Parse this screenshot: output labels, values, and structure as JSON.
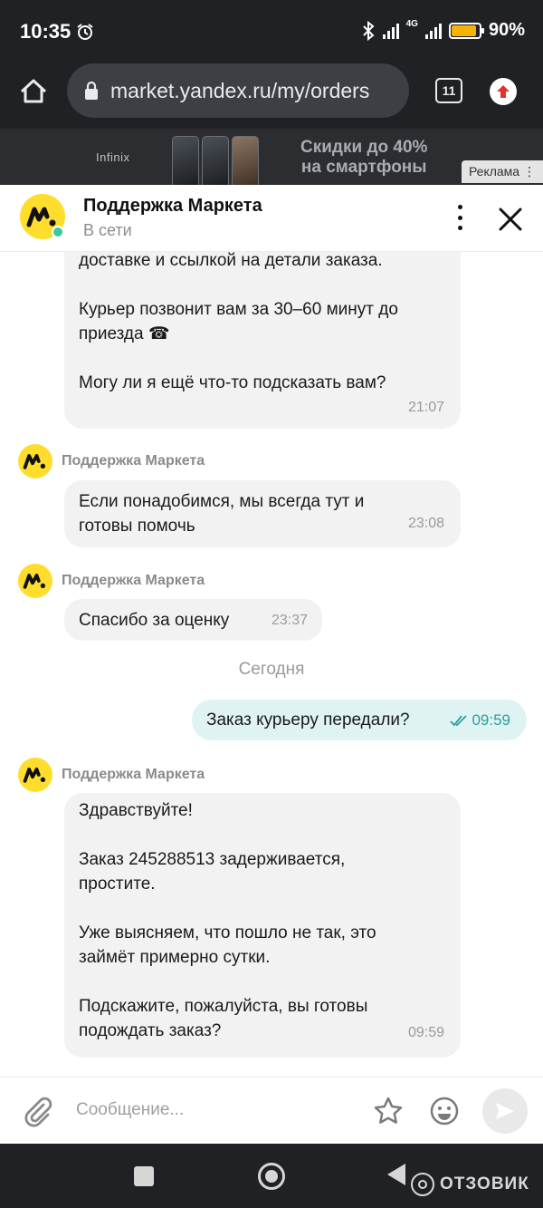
{
  "status_bar": {
    "time": "10:35",
    "network": "4G",
    "battery": "90%",
    "battery_level": 0.9
  },
  "browser": {
    "url": "market.yandex.ru/my/orders",
    "tab_count": "11"
  },
  "ad_banner": {
    "brand": "Infinix",
    "promo_line1": "Скидки до 40%",
    "promo_line2": "на смартфоны",
    "label": "Реклама"
  },
  "chat_header": {
    "title": "Поддержка Маркета",
    "status": "В сети"
  },
  "colors": {
    "accent_yellow": "#ffdd2d",
    "online_green": "#3cc8a0",
    "outgoing_bg": "#dff3f3",
    "outgoing_time": "#2f9c9c"
  },
  "messages": [
    {
      "lines": [
        "доставке и ссылкой на детали заказа.",
        "",
        "Курьер позвонит вам за 30–60 минут до",
        "приезда ☎",
        "",
        "Могу ли я ещё что-то подсказать вам?"
      ],
      "time": "21:07"
    },
    {
      "sender": "Поддержка Маркета",
      "lines": [
        "Если понадобимся, мы всегда тут и",
        "готовы помочь"
      ],
      "time": "23:08"
    },
    {
      "sender": "Поддержка Маркета",
      "lines": [
        "Спасибо за оценку"
      ],
      "time": "23:37"
    },
    {
      "day_separator": "Сегодня"
    },
    {
      "outgoing": true,
      "text": "Заказ курьеру передали?",
      "time": "09:59",
      "read_icon": "double-check-icon"
    },
    {
      "sender": "Поддержка Маркета",
      "lines": [
        "Здравствуйте!",
        "",
        "Заказ 245288513 задерживается,",
        "простите.",
        "",
        "Уже выясняем, что пошло не так, это",
        "займёт примерно сутки.",
        "",
        "Подскажите, пожалуйста, вы готовы",
        "подождать заказ?"
      ],
      "time": "09:59"
    }
  ],
  "composer": {
    "placeholder": "Сообщение..."
  },
  "watermark": {
    "text": "ОТЗОВИК"
  }
}
